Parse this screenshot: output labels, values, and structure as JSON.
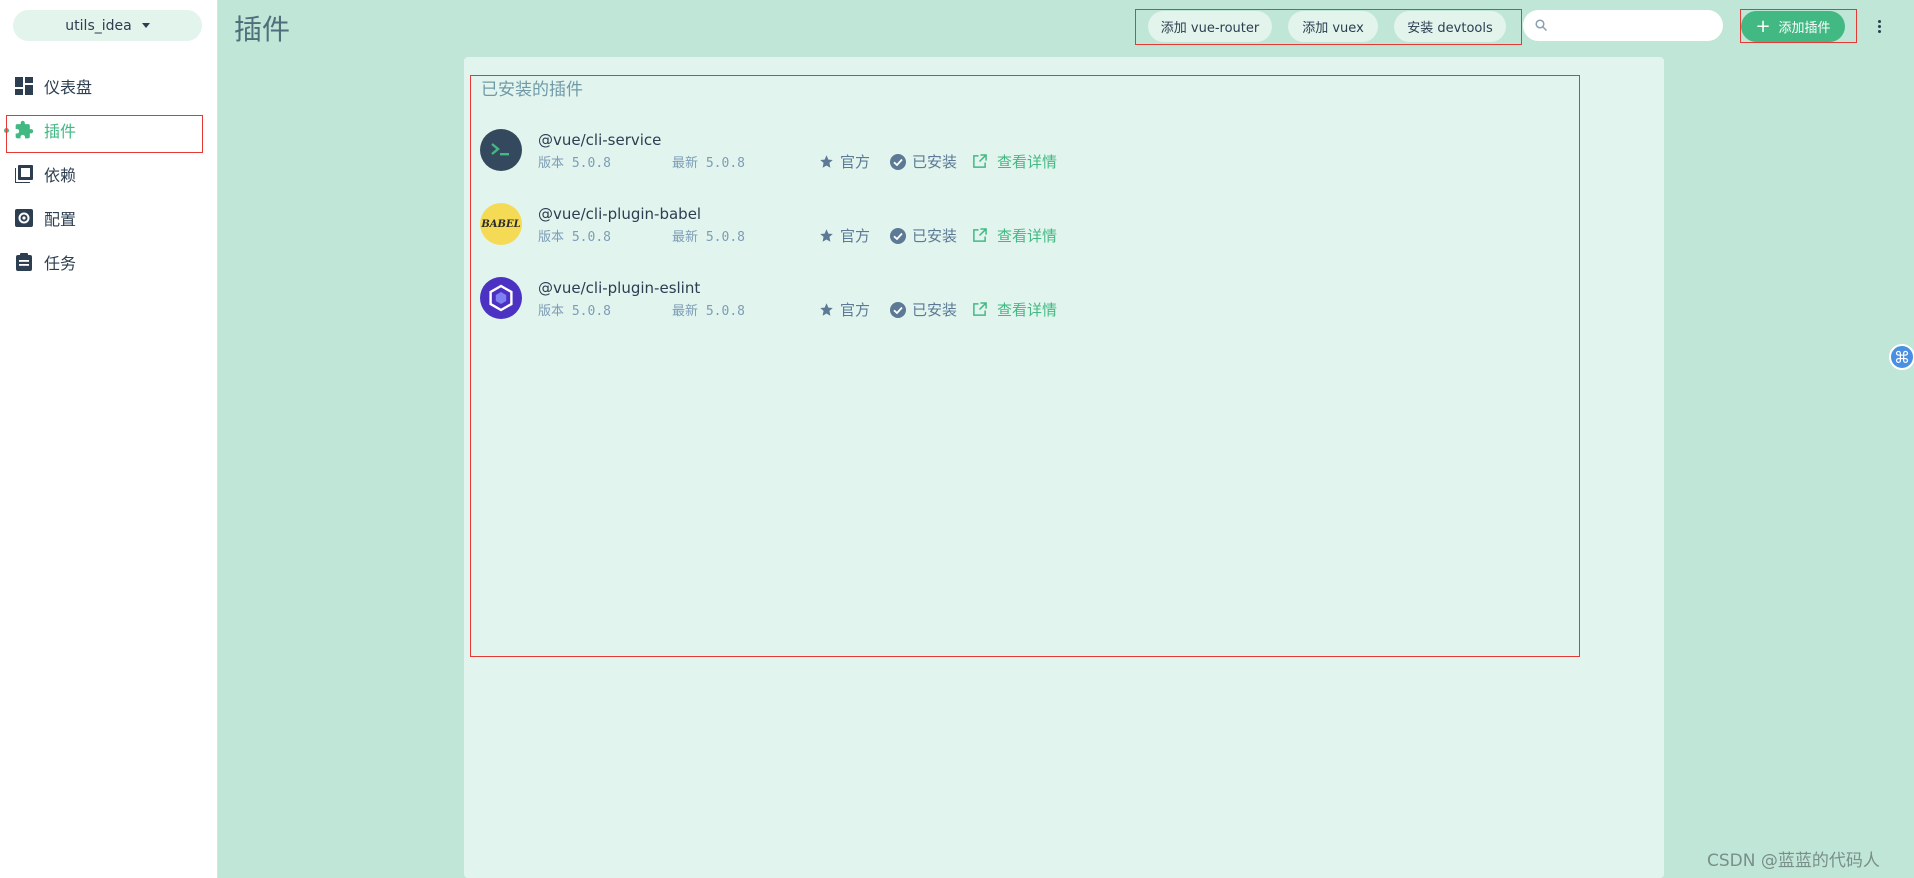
{
  "sidebar": {
    "project": "utils_idea",
    "items": [
      {
        "label": "仪表盘",
        "icon": "dashboard-icon"
      },
      {
        "label": "插件",
        "icon": "puzzle-icon",
        "active": true
      },
      {
        "label": "依赖",
        "icon": "library-icon"
      },
      {
        "label": "配置",
        "icon": "settings-icon"
      },
      {
        "label": "任务",
        "icon": "clipboard-icon"
      }
    ]
  },
  "header": {
    "title": "插件",
    "quick_actions": [
      "添加 vue-router",
      "添加 vuex",
      "安装 devtools"
    ],
    "search_placeholder": "",
    "add_plugin_label": "添加插件"
  },
  "installed": {
    "title": "已安装的插件",
    "plugins": [
      {
        "name": "@vue/cli-service",
        "version_label": "版本",
        "version": "5.0.8",
        "latest_label": "最新",
        "latest": "5.0.8",
        "official": "官方",
        "installed": "已安装",
        "details": "查看详情",
        "logo": "vue-cli-logo-icon"
      },
      {
        "name": "@vue/cli-plugin-babel",
        "version_label": "版本",
        "version": "5.0.8",
        "latest_label": "最新",
        "latest": "5.0.8",
        "official": "官方",
        "installed": "已安装",
        "details": "查看详情",
        "logo": "babel-logo-icon",
        "logo_text": "BABEL"
      },
      {
        "name": "@vue/cli-plugin-eslint",
        "version_label": "版本",
        "version": "5.0.8",
        "latest_label": "最新",
        "latest": "5.0.8",
        "official": "官方",
        "installed": "已安装",
        "details": "查看详情",
        "logo": "eslint-logo-icon"
      }
    ]
  },
  "watermark": "CSDN @蓝蓝的代码人",
  "colors": {
    "accent": "#42b983",
    "background": "#bfe6d6",
    "panel": "#e2f4ee",
    "highlight_border": "#e53935"
  }
}
